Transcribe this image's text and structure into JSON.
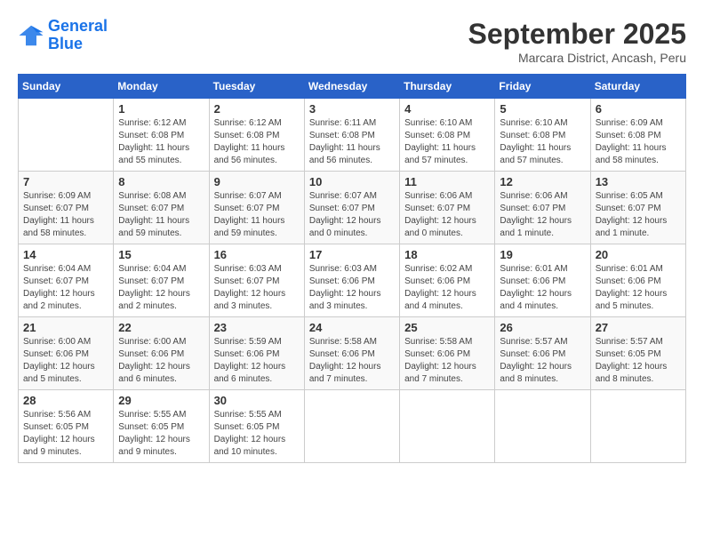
{
  "header": {
    "logo_line1": "General",
    "logo_line2": "Blue",
    "month_title": "September 2025",
    "subtitle": "Marcara District, Ancash, Peru"
  },
  "days_of_week": [
    "Sunday",
    "Monday",
    "Tuesday",
    "Wednesday",
    "Thursday",
    "Friday",
    "Saturday"
  ],
  "weeks": [
    [
      {
        "num": "",
        "info": ""
      },
      {
        "num": "1",
        "info": "Sunrise: 6:12 AM\nSunset: 6:08 PM\nDaylight: 11 hours\nand 55 minutes."
      },
      {
        "num": "2",
        "info": "Sunrise: 6:12 AM\nSunset: 6:08 PM\nDaylight: 11 hours\nand 56 minutes."
      },
      {
        "num": "3",
        "info": "Sunrise: 6:11 AM\nSunset: 6:08 PM\nDaylight: 11 hours\nand 56 minutes."
      },
      {
        "num": "4",
        "info": "Sunrise: 6:10 AM\nSunset: 6:08 PM\nDaylight: 11 hours\nand 57 minutes."
      },
      {
        "num": "5",
        "info": "Sunrise: 6:10 AM\nSunset: 6:08 PM\nDaylight: 11 hours\nand 57 minutes."
      },
      {
        "num": "6",
        "info": "Sunrise: 6:09 AM\nSunset: 6:08 PM\nDaylight: 11 hours\nand 58 minutes."
      }
    ],
    [
      {
        "num": "7",
        "info": "Sunrise: 6:09 AM\nSunset: 6:07 PM\nDaylight: 11 hours\nand 58 minutes."
      },
      {
        "num": "8",
        "info": "Sunrise: 6:08 AM\nSunset: 6:07 PM\nDaylight: 11 hours\nand 59 minutes."
      },
      {
        "num": "9",
        "info": "Sunrise: 6:07 AM\nSunset: 6:07 PM\nDaylight: 11 hours\nand 59 minutes."
      },
      {
        "num": "10",
        "info": "Sunrise: 6:07 AM\nSunset: 6:07 PM\nDaylight: 12 hours\nand 0 minutes."
      },
      {
        "num": "11",
        "info": "Sunrise: 6:06 AM\nSunset: 6:07 PM\nDaylight: 12 hours\nand 0 minutes."
      },
      {
        "num": "12",
        "info": "Sunrise: 6:06 AM\nSunset: 6:07 PM\nDaylight: 12 hours\nand 1 minute."
      },
      {
        "num": "13",
        "info": "Sunrise: 6:05 AM\nSunset: 6:07 PM\nDaylight: 12 hours\nand 1 minute."
      }
    ],
    [
      {
        "num": "14",
        "info": "Sunrise: 6:04 AM\nSunset: 6:07 PM\nDaylight: 12 hours\nand 2 minutes."
      },
      {
        "num": "15",
        "info": "Sunrise: 6:04 AM\nSunset: 6:07 PM\nDaylight: 12 hours\nand 2 minutes."
      },
      {
        "num": "16",
        "info": "Sunrise: 6:03 AM\nSunset: 6:07 PM\nDaylight: 12 hours\nand 3 minutes."
      },
      {
        "num": "17",
        "info": "Sunrise: 6:03 AM\nSunset: 6:06 PM\nDaylight: 12 hours\nand 3 minutes."
      },
      {
        "num": "18",
        "info": "Sunrise: 6:02 AM\nSunset: 6:06 PM\nDaylight: 12 hours\nand 4 minutes."
      },
      {
        "num": "19",
        "info": "Sunrise: 6:01 AM\nSunset: 6:06 PM\nDaylight: 12 hours\nand 4 minutes."
      },
      {
        "num": "20",
        "info": "Sunrise: 6:01 AM\nSunset: 6:06 PM\nDaylight: 12 hours\nand 5 minutes."
      }
    ],
    [
      {
        "num": "21",
        "info": "Sunrise: 6:00 AM\nSunset: 6:06 PM\nDaylight: 12 hours\nand 5 minutes."
      },
      {
        "num": "22",
        "info": "Sunrise: 6:00 AM\nSunset: 6:06 PM\nDaylight: 12 hours\nand 6 minutes."
      },
      {
        "num": "23",
        "info": "Sunrise: 5:59 AM\nSunset: 6:06 PM\nDaylight: 12 hours\nand 6 minutes."
      },
      {
        "num": "24",
        "info": "Sunrise: 5:58 AM\nSunset: 6:06 PM\nDaylight: 12 hours\nand 7 minutes."
      },
      {
        "num": "25",
        "info": "Sunrise: 5:58 AM\nSunset: 6:06 PM\nDaylight: 12 hours\nand 7 minutes."
      },
      {
        "num": "26",
        "info": "Sunrise: 5:57 AM\nSunset: 6:06 PM\nDaylight: 12 hours\nand 8 minutes."
      },
      {
        "num": "27",
        "info": "Sunrise: 5:57 AM\nSunset: 6:05 PM\nDaylight: 12 hours\nand 8 minutes."
      }
    ],
    [
      {
        "num": "28",
        "info": "Sunrise: 5:56 AM\nSunset: 6:05 PM\nDaylight: 12 hours\nand 9 minutes."
      },
      {
        "num": "29",
        "info": "Sunrise: 5:55 AM\nSunset: 6:05 PM\nDaylight: 12 hours\nand 9 minutes."
      },
      {
        "num": "30",
        "info": "Sunrise: 5:55 AM\nSunset: 6:05 PM\nDaylight: 12 hours\nand 10 minutes."
      },
      {
        "num": "",
        "info": ""
      },
      {
        "num": "",
        "info": ""
      },
      {
        "num": "",
        "info": ""
      },
      {
        "num": "",
        "info": ""
      }
    ]
  ]
}
